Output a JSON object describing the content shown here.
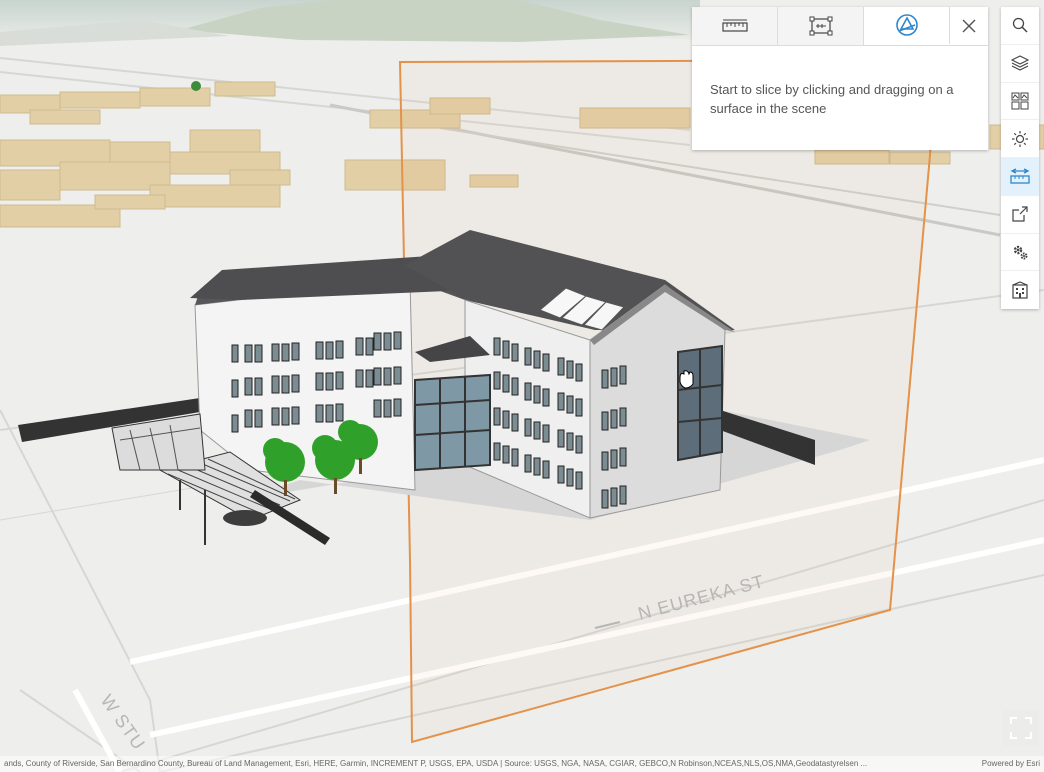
{
  "scene": {
    "street_label_1": "N EUREKA ST",
    "street_label_2": "W STU"
  },
  "slice_panel": {
    "tabs": [
      {
        "icon": "measure-distance-icon",
        "active": false
      },
      {
        "icon": "measure-area-icon",
        "active": false
      },
      {
        "icon": "slice-icon",
        "active": true
      }
    ],
    "close_icon": "close-icon",
    "message": "Start to slice by clicking and dragging on a surface in the scene"
  },
  "toolbar": {
    "buttons": [
      {
        "icon": "search-icon",
        "active": false
      },
      {
        "icon": "layers-icon",
        "active": false
      },
      {
        "icon": "basemap-gallery-icon",
        "active": false
      },
      {
        "icon": "daylight-icon",
        "active": false
      },
      {
        "icon": "measure-line-icon",
        "active": true
      },
      {
        "icon": "share-icon",
        "active": false
      },
      {
        "icon": "settings-gears-icon",
        "active": false
      },
      {
        "icon": "building-explorer-icon",
        "active": false
      }
    ]
  },
  "fullscreen": {
    "icon": "fullscreen-icon"
  },
  "attribution": {
    "text": "ands, County of Riverside, San Bernardino County, Bureau of Land Management, Esri, HERE, Garmin, INCREMENT P, USGS, EPA, USDA | Source: USGS, NGA, NASA, CGIAR, GEBCO,N Robinson,NCEAS,NLS,OS,NMA,Geodatastyrelsen ...",
    "powered_by": "Powered by Esri"
  },
  "colors": {
    "accent": "#2f87c9",
    "slice_plane": "#e4924a",
    "context_buildings": "#e2cfa6",
    "roof": "#4e4e50",
    "tree": "#2fa12a"
  }
}
